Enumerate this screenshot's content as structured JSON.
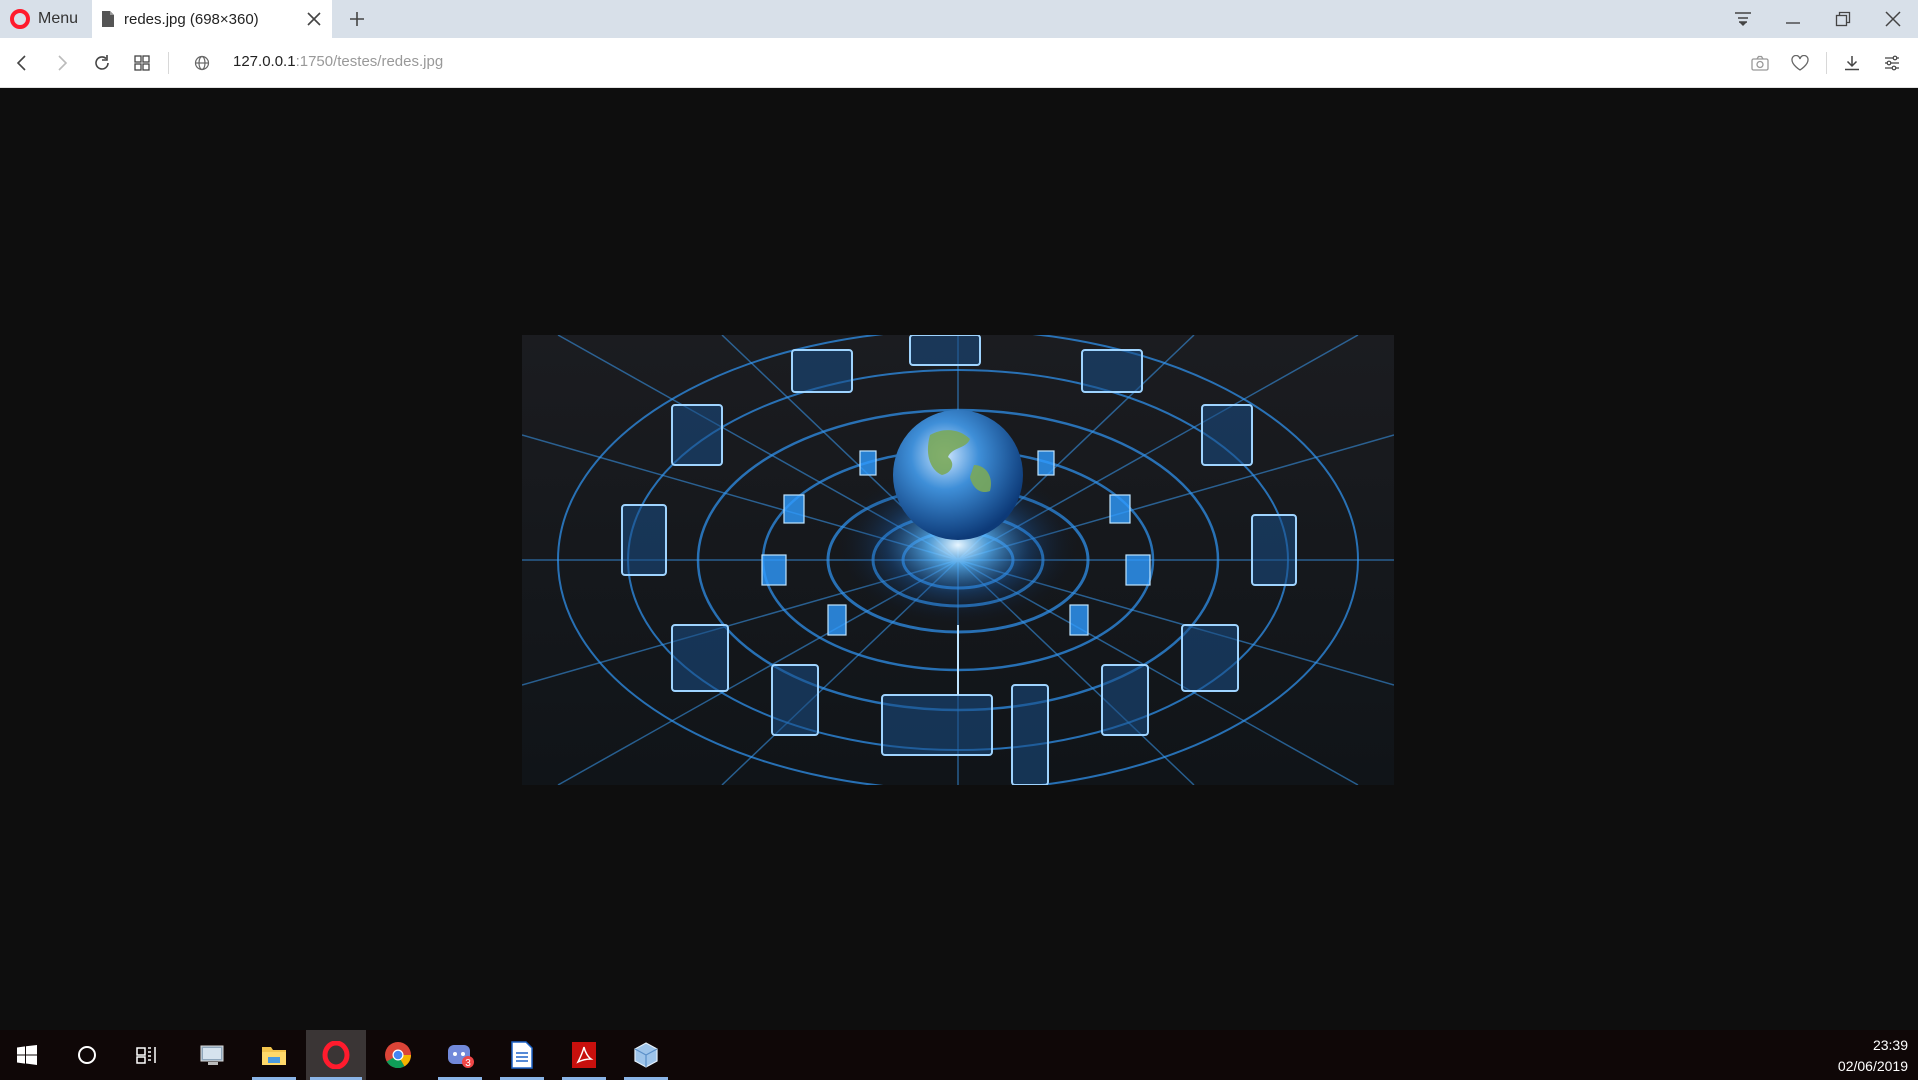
{
  "browser": {
    "menu_label": "Menu",
    "tab": {
      "title": "redes.jpg (698×360)"
    },
    "url": {
      "host": "127.0.0.1",
      "rest": ":1750/testes/redes.jpg"
    },
    "accent": "#ff1b2d"
  },
  "taskbar": {
    "time": "23:39",
    "date": "02/06/2019",
    "discord_badge": "3"
  }
}
